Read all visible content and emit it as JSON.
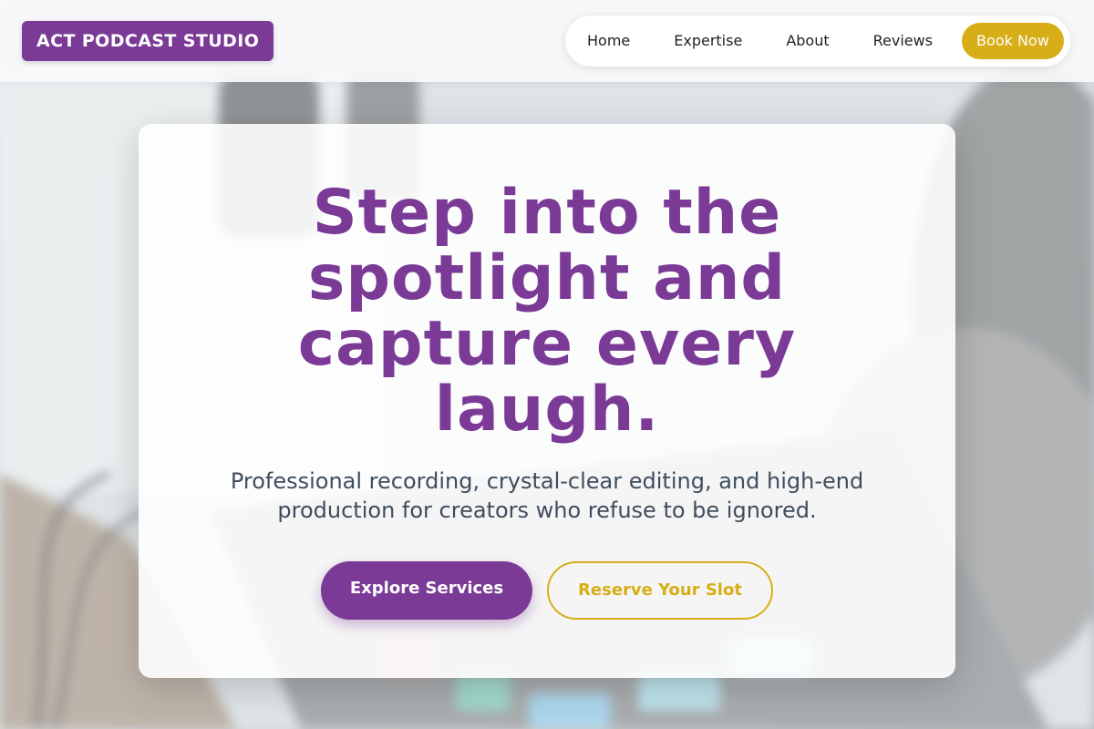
{
  "header": {
    "logo_text": "ACT PODCAST STUDIO",
    "nav": [
      {
        "label": "Home"
      },
      {
        "label": "Expertise"
      },
      {
        "label": "About"
      },
      {
        "label": "Reviews"
      }
    ],
    "cta_label": "Book Now"
  },
  "hero": {
    "title": "Step into the spotlight and capture every laugh.",
    "subtitle": "Professional recording, crystal-clear editing, and high-end production for creators who refuse to be ignored.",
    "primary_button": "Explore Services",
    "secondary_button": "Reserve Your Slot"
  },
  "colors": {
    "brand_purple": "#7b3a96",
    "accent_gold": "#d7ae17",
    "subtitle_text": "#3f4d5e",
    "nav_text": "#222222"
  },
  "background": {
    "description_icon": "studio-mixer-background-image"
  }
}
